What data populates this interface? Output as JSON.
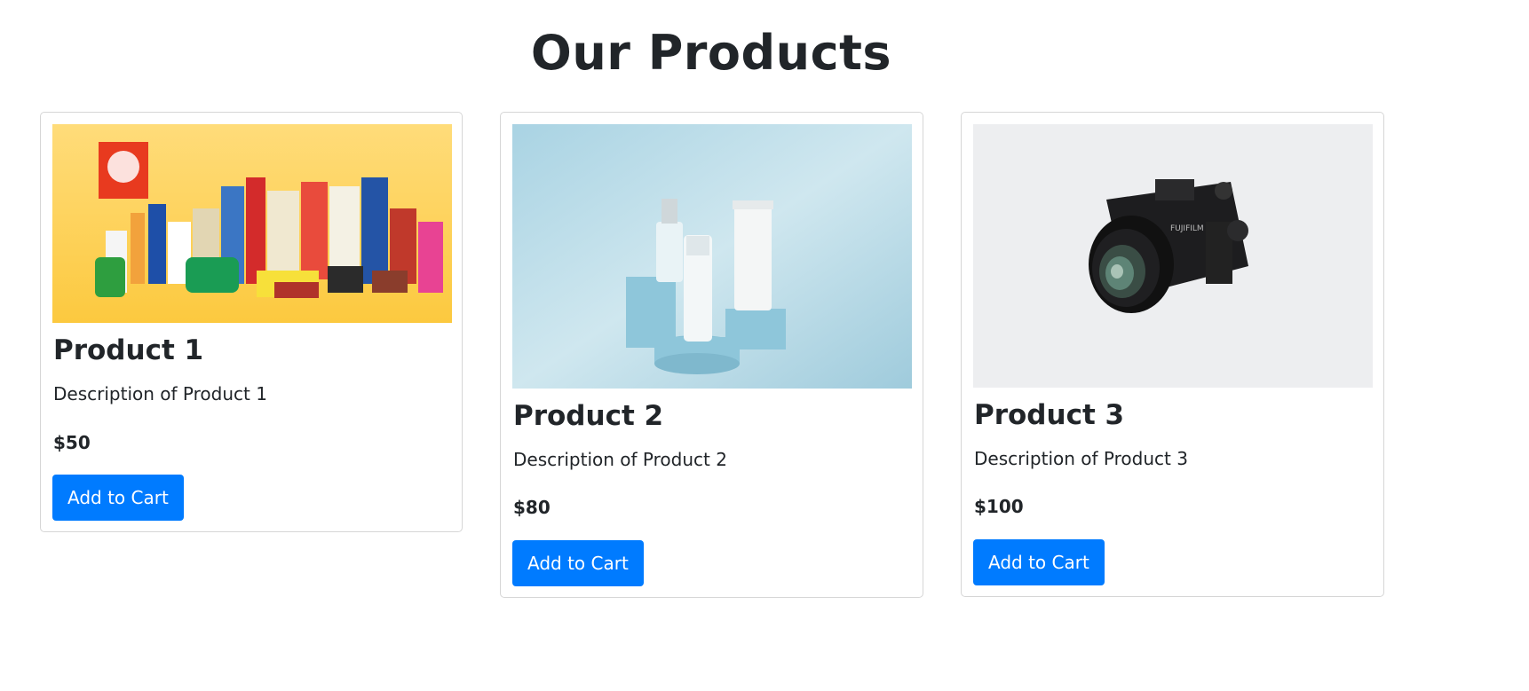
{
  "page": {
    "title": "Our Products"
  },
  "products": [
    {
      "name": "Product 1",
      "description": "Description of Product 1",
      "price": "$50",
      "button_label": "Add to Cart",
      "image_icon": "consumer-products-image"
    },
    {
      "name": "Product 2",
      "description": "Description of Product 2",
      "price": "$80",
      "button_label": "Add to Cart",
      "image_icon": "cosmetic-bottles-image"
    },
    {
      "name": "Product 3",
      "description": "Description of Product 3",
      "price": "$100",
      "button_label": "Add to Cart",
      "image_icon": "camera-image"
    }
  ],
  "colors": {
    "button": "#007bff",
    "button_text": "#ffffff",
    "text": "#212529",
    "card_border": "#d6d6d6",
    "image1_bg": "#fdd468",
    "image2_bg": "#bcdde8",
    "image3_bg": "#edeef0"
  }
}
